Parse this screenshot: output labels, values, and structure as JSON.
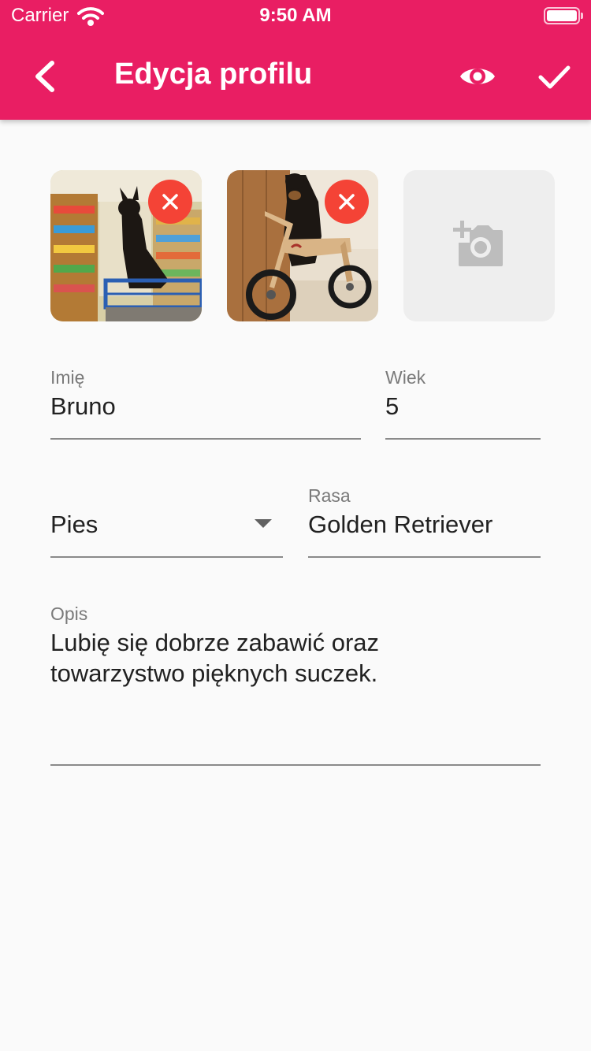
{
  "status_bar": {
    "carrier": "Carrier",
    "time": "9:50 AM"
  },
  "app_bar": {
    "title": "Edycja profilu",
    "icons": [
      "back-arrow-icon",
      "eye-icon",
      "check-icon"
    ],
    "color": "#e91e63"
  },
  "photos": {
    "items": [
      {
        "description_icon": "dog-in-shopping-cart-photo"
      },
      {
        "description_icon": "dog-on-balance-bike-photo"
      }
    ],
    "remove_color": "#f44336",
    "add_icon": "add-a-photo-icon"
  },
  "form": {
    "name": {
      "label": "Imię",
      "value": "Bruno"
    },
    "age": {
      "label": "Wiek",
      "value": "5"
    },
    "species": {
      "value": "Pies"
    },
    "breed": {
      "label": "Rasa",
      "value": "Golden Retriever"
    },
    "description": {
      "label": "Opis",
      "value": "Lubię się dobrze zabawić oraz\ntowarzystwo pięknych suczek."
    }
  }
}
